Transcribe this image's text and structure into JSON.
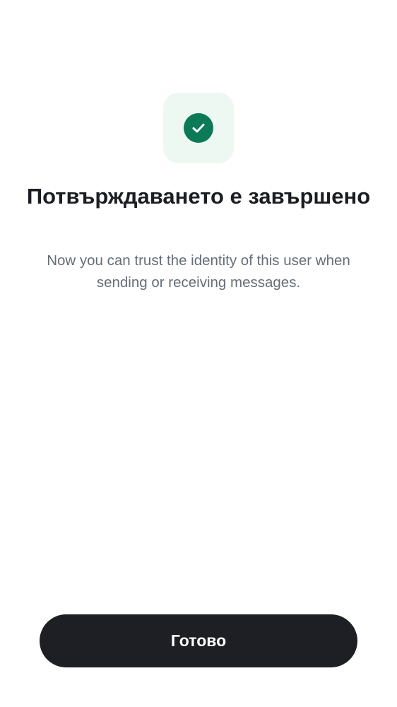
{
  "verification": {
    "status_icon": "check-circle-icon",
    "title": "Потвърждаването е завършено",
    "subtitle": "Now you can trust the identity of this user when sending or receiving messages."
  },
  "actions": {
    "done_label": "Готово"
  },
  "colors": {
    "accent_green": "#0b7a56",
    "icon_tile_background": "#eef8f2",
    "title_text": "#1b1d22",
    "subtitle_text": "#656d77",
    "button_background": "#1e1f24",
    "button_text": "#ffffff"
  }
}
